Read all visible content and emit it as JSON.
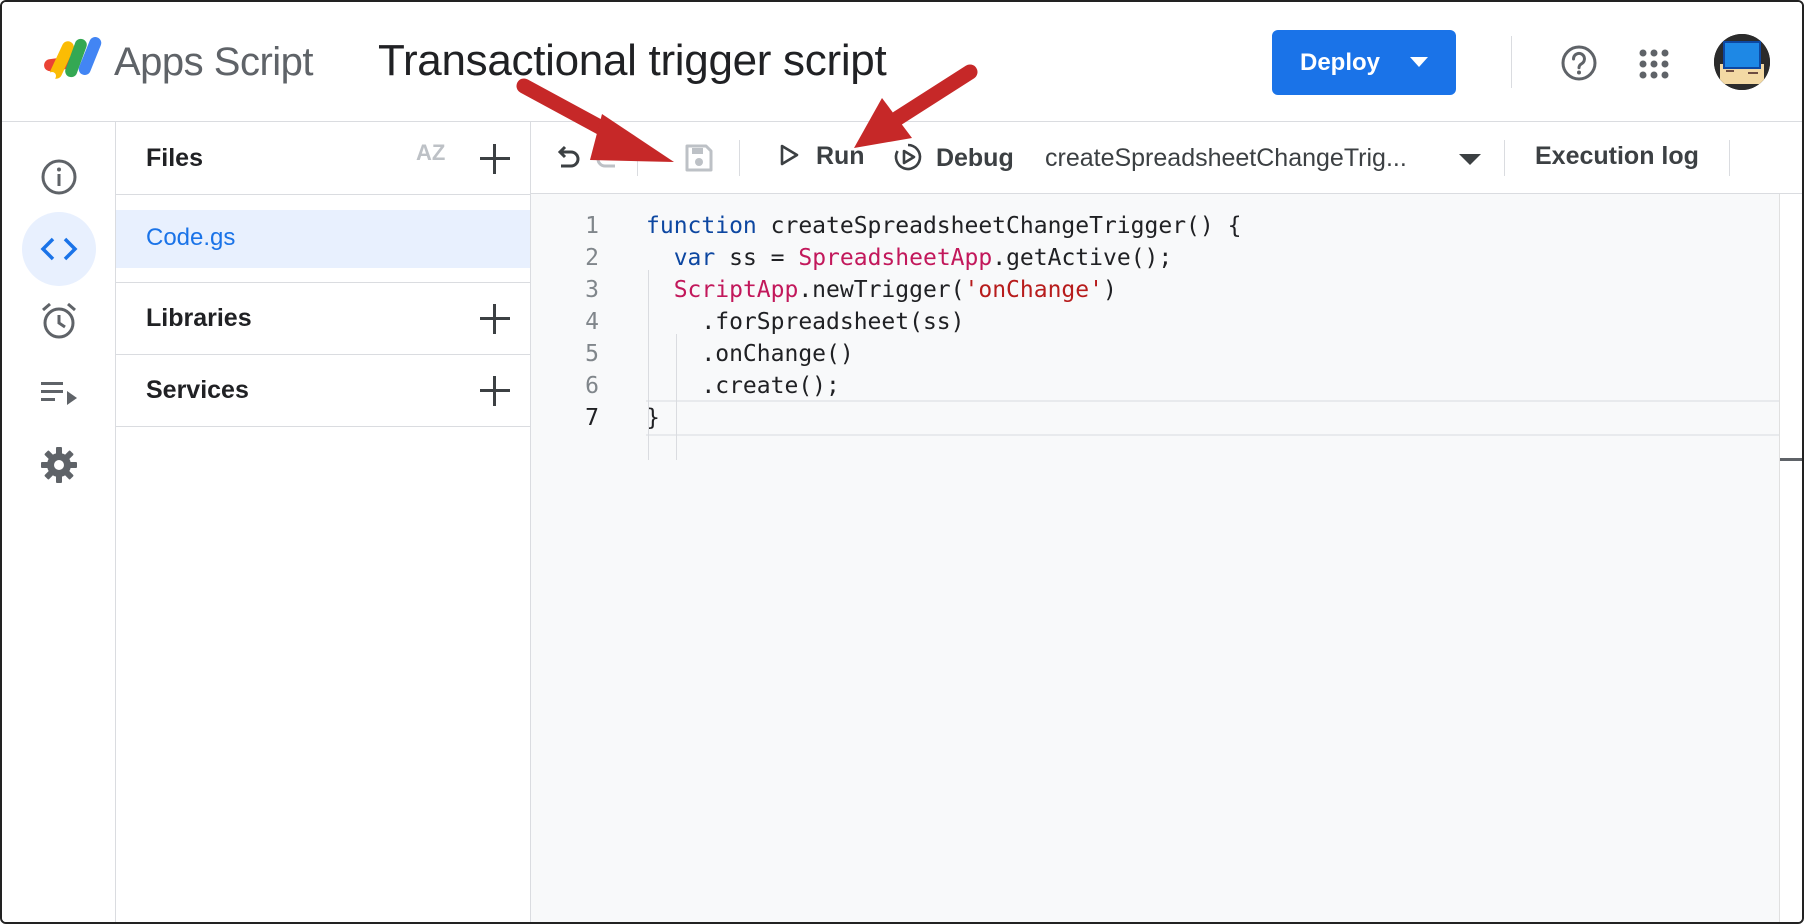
{
  "header": {
    "app_name": "Apps Script",
    "project_title": "Transactional trigger script",
    "deploy_label": "Deploy"
  },
  "files_panel": {
    "files_label": "Files",
    "sort_label": "AZ",
    "files": [
      "Code.gs"
    ],
    "libraries_label": "Libraries",
    "services_label": "Services"
  },
  "toolbar": {
    "run_label": "Run",
    "debug_label": "Debug",
    "function_selected": "createSpreadsheetChangeTrig...",
    "execution_log_label": "Execution log"
  },
  "editor": {
    "line_numbers": [
      "1",
      "2",
      "3",
      "4",
      "5",
      "6",
      "7"
    ],
    "lines": [
      [
        {
          "t": "function",
          "c": "kw"
        },
        {
          "t": " createSpreadsheetChangeTrigger() {",
          "c": ""
        }
      ],
      [
        {
          "t": "  ",
          "c": ""
        },
        {
          "t": "var",
          "c": "kw"
        },
        {
          "t": " ss = ",
          "c": ""
        },
        {
          "t": "SpreadsheetApp",
          "c": "cls"
        },
        {
          "t": ".getActive();",
          "c": ""
        }
      ],
      [
        {
          "t": "  ",
          "c": ""
        },
        {
          "t": "ScriptApp",
          "c": "cls"
        },
        {
          "t": ".newTrigger(",
          "c": ""
        },
        {
          "t": "'onChange'",
          "c": "str"
        },
        {
          "t": ")",
          "c": ""
        }
      ],
      [
        {
          "t": "    .forSpreadsheet(ss)",
          "c": ""
        }
      ],
      [
        {
          "t": "    .onChange()",
          "c": ""
        }
      ],
      [
        {
          "t": "    .create();",
          "c": ""
        }
      ],
      [
        {
          "t": "}",
          "c": ""
        }
      ]
    ],
    "current_line": 7
  },
  "rail": {
    "icons": [
      "info-icon",
      "code-icon",
      "alarm-icon",
      "executions-icon",
      "settings-icon"
    ],
    "active": "code-icon"
  },
  "colors": {
    "accent": "#1a73e8",
    "keyword": "#0d47a1",
    "class": "#c2185b",
    "string": "#b71c1c",
    "arrow": "#c62828"
  }
}
